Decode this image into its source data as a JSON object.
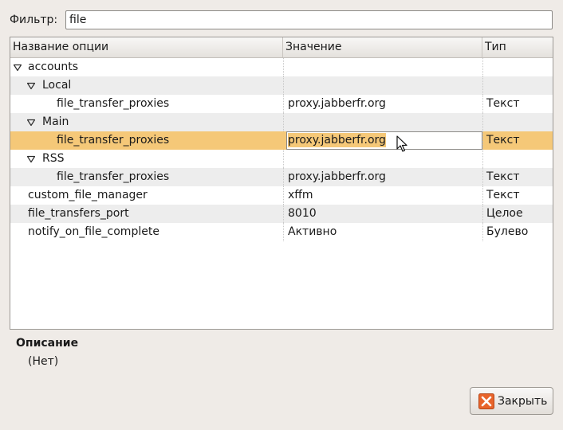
{
  "filter": {
    "label": "Фильтр:",
    "value": "file"
  },
  "columns": {
    "name": "Название опции",
    "value": "Значение",
    "type": "Тип"
  },
  "rows": [
    {
      "name": "accounts",
      "value": "",
      "type": "",
      "expander": true
    },
    {
      "name": "Local",
      "value": "",
      "type": "",
      "expander": true
    },
    {
      "name": "file_transfer_proxies",
      "value": "proxy.jabberfr.org",
      "type": "Текст"
    },
    {
      "name": "Main",
      "value": "",
      "type": "",
      "expander": true
    },
    {
      "name": "file_transfer_proxies",
      "value": "proxy.jabberfr.org",
      "type": "Текст",
      "selected": true
    },
    {
      "name": "RSS",
      "value": "",
      "type": "",
      "expander": true
    },
    {
      "name": "file_transfer_proxies",
      "value": "proxy.jabberfr.org",
      "type": "Текст"
    },
    {
      "name": "custom_file_manager",
      "value": "xffm",
      "type": "Текст"
    },
    {
      "name": "file_transfers_port",
      "value": "8010",
      "type": "Целое"
    },
    {
      "name": "notify_on_file_complete",
      "value": "Активно",
      "type": "Булево"
    }
  ],
  "description": {
    "title": "Описание",
    "value": "(Нет)"
  },
  "close_button": {
    "label": "Закрыть"
  },
  "icons": {
    "expander": "triangle-down-icon",
    "close": "close-x-icon",
    "cursor": "text-cursor-icon"
  },
  "colors": {
    "selection": "#f5c878",
    "close_icon": "#e8642b"
  }
}
